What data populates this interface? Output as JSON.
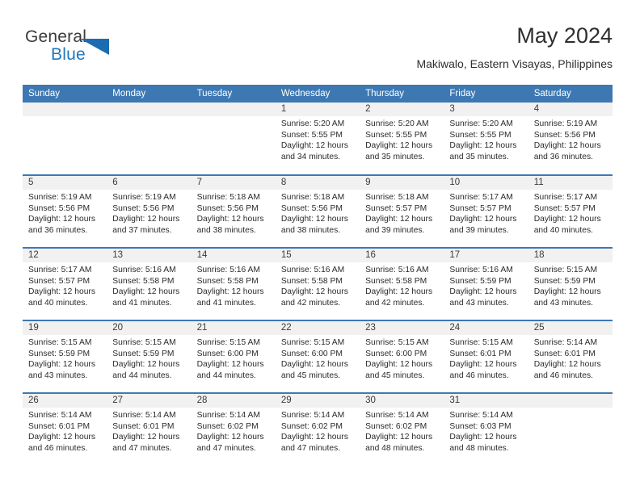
{
  "logo": {
    "word1": "General",
    "word2": "Blue",
    "triangle_color": "#1b6cb0",
    "word1_color": "#3b3b3b",
    "word2_color": "#2077bc",
    "icon": "general-blue-logo-icon"
  },
  "header": {
    "title": "May 2024",
    "subtitle": "Makiwalo, Eastern Visayas, Philippines",
    "accent_color": "#3d78b2",
    "daynum_strip_color": "#f1f1f1"
  },
  "weekday_headers": [
    "Sunday",
    "Monday",
    "Tuesday",
    "Wednesday",
    "Thursday",
    "Friday",
    "Saturday"
  ],
  "labels": {
    "sunrise": "Sunrise:",
    "sunset": "Sunset:",
    "daylight": "Daylight:"
  },
  "weeks": [
    [
      {
        "day": "",
        "sunrise": "",
        "sunset": "",
        "daylight_line1": "",
        "daylight_line2": ""
      },
      {
        "day": "",
        "sunrise": "",
        "sunset": "",
        "daylight_line1": "",
        "daylight_line2": ""
      },
      {
        "day": "",
        "sunrise": "",
        "sunset": "",
        "daylight_line1": "",
        "daylight_line2": ""
      },
      {
        "day": "1",
        "sunrise": "Sunrise: 5:20 AM",
        "sunset": "Sunset: 5:55 PM",
        "daylight_line1": "Daylight: 12 hours",
        "daylight_line2": "and 34 minutes."
      },
      {
        "day": "2",
        "sunrise": "Sunrise: 5:20 AM",
        "sunset": "Sunset: 5:55 PM",
        "daylight_line1": "Daylight: 12 hours",
        "daylight_line2": "and 35 minutes."
      },
      {
        "day": "3",
        "sunrise": "Sunrise: 5:20 AM",
        "sunset": "Sunset: 5:55 PM",
        "daylight_line1": "Daylight: 12 hours",
        "daylight_line2": "and 35 minutes."
      },
      {
        "day": "4",
        "sunrise": "Sunrise: 5:19 AM",
        "sunset": "Sunset: 5:56 PM",
        "daylight_line1": "Daylight: 12 hours",
        "daylight_line2": "and 36 minutes."
      }
    ],
    [
      {
        "day": "5",
        "sunrise": "Sunrise: 5:19 AM",
        "sunset": "Sunset: 5:56 PM",
        "daylight_line1": "Daylight: 12 hours",
        "daylight_line2": "and 36 minutes."
      },
      {
        "day": "6",
        "sunrise": "Sunrise: 5:19 AM",
        "sunset": "Sunset: 5:56 PM",
        "daylight_line1": "Daylight: 12 hours",
        "daylight_line2": "and 37 minutes."
      },
      {
        "day": "7",
        "sunrise": "Sunrise: 5:18 AM",
        "sunset": "Sunset: 5:56 PM",
        "daylight_line1": "Daylight: 12 hours",
        "daylight_line2": "and 38 minutes."
      },
      {
        "day": "8",
        "sunrise": "Sunrise: 5:18 AM",
        "sunset": "Sunset: 5:56 PM",
        "daylight_line1": "Daylight: 12 hours",
        "daylight_line2": "and 38 minutes."
      },
      {
        "day": "9",
        "sunrise": "Sunrise: 5:18 AM",
        "sunset": "Sunset: 5:57 PM",
        "daylight_line1": "Daylight: 12 hours",
        "daylight_line2": "and 39 minutes."
      },
      {
        "day": "10",
        "sunrise": "Sunrise: 5:17 AM",
        "sunset": "Sunset: 5:57 PM",
        "daylight_line1": "Daylight: 12 hours",
        "daylight_line2": "and 39 minutes."
      },
      {
        "day": "11",
        "sunrise": "Sunrise: 5:17 AM",
        "sunset": "Sunset: 5:57 PM",
        "daylight_line1": "Daylight: 12 hours",
        "daylight_line2": "and 40 minutes."
      }
    ],
    [
      {
        "day": "12",
        "sunrise": "Sunrise: 5:17 AM",
        "sunset": "Sunset: 5:57 PM",
        "daylight_line1": "Daylight: 12 hours",
        "daylight_line2": "and 40 minutes."
      },
      {
        "day": "13",
        "sunrise": "Sunrise: 5:16 AM",
        "sunset": "Sunset: 5:58 PM",
        "daylight_line1": "Daylight: 12 hours",
        "daylight_line2": "and 41 minutes."
      },
      {
        "day": "14",
        "sunrise": "Sunrise: 5:16 AM",
        "sunset": "Sunset: 5:58 PM",
        "daylight_line1": "Daylight: 12 hours",
        "daylight_line2": "and 41 minutes."
      },
      {
        "day": "15",
        "sunrise": "Sunrise: 5:16 AM",
        "sunset": "Sunset: 5:58 PM",
        "daylight_line1": "Daylight: 12 hours",
        "daylight_line2": "and 42 minutes."
      },
      {
        "day": "16",
        "sunrise": "Sunrise: 5:16 AM",
        "sunset": "Sunset: 5:58 PM",
        "daylight_line1": "Daylight: 12 hours",
        "daylight_line2": "and 42 minutes."
      },
      {
        "day": "17",
        "sunrise": "Sunrise: 5:16 AM",
        "sunset": "Sunset: 5:59 PM",
        "daylight_line1": "Daylight: 12 hours",
        "daylight_line2": "and 43 minutes."
      },
      {
        "day": "18",
        "sunrise": "Sunrise: 5:15 AM",
        "sunset": "Sunset: 5:59 PM",
        "daylight_line1": "Daylight: 12 hours",
        "daylight_line2": "and 43 minutes."
      }
    ],
    [
      {
        "day": "19",
        "sunrise": "Sunrise: 5:15 AM",
        "sunset": "Sunset: 5:59 PM",
        "daylight_line1": "Daylight: 12 hours",
        "daylight_line2": "and 43 minutes."
      },
      {
        "day": "20",
        "sunrise": "Sunrise: 5:15 AM",
        "sunset": "Sunset: 5:59 PM",
        "daylight_line1": "Daylight: 12 hours",
        "daylight_line2": "and 44 minutes."
      },
      {
        "day": "21",
        "sunrise": "Sunrise: 5:15 AM",
        "sunset": "Sunset: 6:00 PM",
        "daylight_line1": "Daylight: 12 hours",
        "daylight_line2": "and 44 minutes."
      },
      {
        "day": "22",
        "sunrise": "Sunrise: 5:15 AM",
        "sunset": "Sunset: 6:00 PM",
        "daylight_line1": "Daylight: 12 hours",
        "daylight_line2": "and 45 minutes."
      },
      {
        "day": "23",
        "sunrise": "Sunrise: 5:15 AM",
        "sunset": "Sunset: 6:00 PM",
        "daylight_line1": "Daylight: 12 hours",
        "daylight_line2": "and 45 minutes."
      },
      {
        "day": "24",
        "sunrise": "Sunrise: 5:15 AM",
        "sunset": "Sunset: 6:01 PM",
        "daylight_line1": "Daylight: 12 hours",
        "daylight_line2": "and 46 minutes."
      },
      {
        "day": "25",
        "sunrise": "Sunrise: 5:14 AM",
        "sunset": "Sunset: 6:01 PM",
        "daylight_line1": "Daylight: 12 hours",
        "daylight_line2": "and 46 minutes."
      }
    ],
    [
      {
        "day": "26",
        "sunrise": "Sunrise: 5:14 AM",
        "sunset": "Sunset: 6:01 PM",
        "daylight_line1": "Daylight: 12 hours",
        "daylight_line2": "and 46 minutes."
      },
      {
        "day": "27",
        "sunrise": "Sunrise: 5:14 AM",
        "sunset": "Sunset: 6:01 PM",
        "daylight_line1": "Daylight: 12 hours",
        "daylight_line2": "and 47 minutes."
      },
      {
        "day": "28",
        "sunrise": "Sunrise: 5:14 AM",
        "sunset": "Sunset: 6:02 PM",
        "daylight_line1": "Daylight: 12 hours",
        "daylight_line2": "and 47 minutes."
      },
      {
        "day": "29",
        "sunrise": "Sunrise: 5:14 AM",
        "sunset": "Sunset: 6:02 PM",
        "daylight_line1": "Daylight: 12 hours",
        "daylight_line2": "and 47 minutes."
      },
      {
        "day": "30",
        "sunrise": "Sunrise: 5:14 AM",
        "sunset": "Sunset: 6:02 PM",
        "daylight_line1": "Daylight: 12 hours",
        "daylight_line2": "and 48 minutes."
      },
      {
        "day": "31",
        "sunrise": "Sunrise: 5:14 AM",
        "sunset": "Sunset: 6:03 PM",
        "daylight_line1": "Daylight: 12 hours",
        "daylight_line2": "and 48 minutes."
      },
      {
        "day": "",
        "sunrise": "",
        "sunset": "",
        "daylight_line1": "",
        "daylight_line2": ""
      }
    ]
  ]
}
